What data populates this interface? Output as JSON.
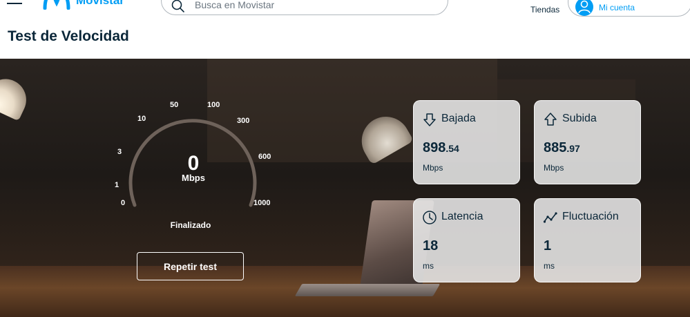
{
  "header": {
    "brand": "Movistar",
    "search_placeholder": "Busca en Movistar",
    "stores_label": "Tiendas",
    "account_label": "Mi cuenta"
  },
  "page": {
    "title": "Test de Velocidad"
  },
  "gauge": {
    "value": "0",
    "unit": "Mbps",
    "scale": [
      "0",
      "1",
      "3",
      "10",
      "50",
      "100",
      "300",
      "600",
      "1000"
    ],
    "status": "Finalizado",
    "button_label": "Repetir test"
  },
  "metrics": {
    "download": {
      "title": "Bajada",
      "value_int": "898",
      "value_dec": ".54",
      "unit": "Mbps",
      "icon": "arrow-down-icon"
    },
    "upload": {
      "title": "Subida",
      "value_int": "885",
      "value_dec": ".97",
      "unit": "Mbps",
      "icon": "arrow-up-icon"
    },
    "latency": {
      "title": "Latencia",
      "value_int": "18",
      "value_dec": "",
      "unit": "ms",
      "icon": "clock-icon"
    },
    "jitter": {
      "title": "Fluctuación",
      "value_int": "1",
      "value_dec": "",
      "unit": "ms",
      "icon": "trend-line-icon"
    }
  },
  "colors": {
    "brand": "#019df4",
    "text_dark": "#0b2739",
    "gauge_arc": "#7a6e66"
  }
}
